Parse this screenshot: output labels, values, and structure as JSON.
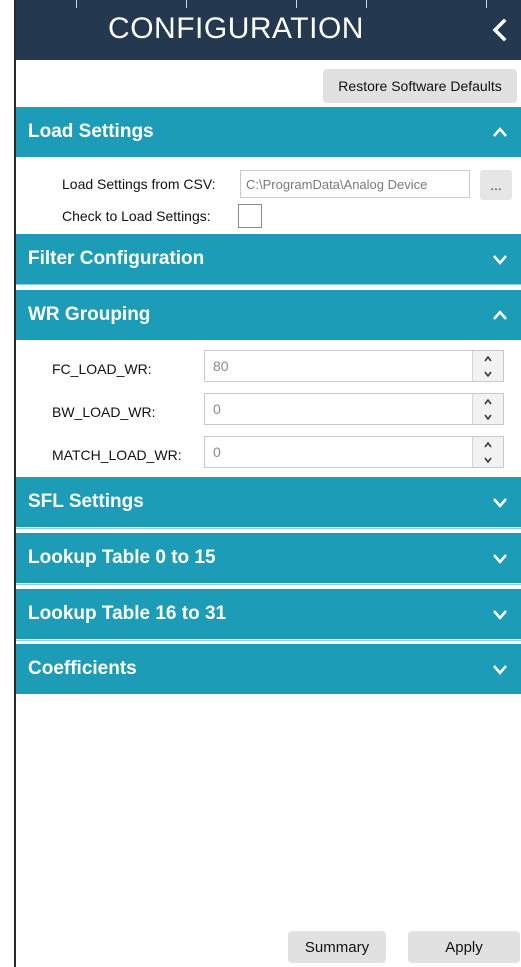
{
  "header": {
    "title": "CONFIGURATION",
    "collapse_icon": "chevron-left-icon"
  },
  "toolbar": {
    "restore_label": "Restore Software Defaults"
  },
  "sections": {
    "load_settings": {
      "title": "Load Settings",
      "expanded": true,
      "csv_label": "Load Settings from CSV:",
      "csv_path": "C:\\ProgramData\\Analog Device",
      "browse_label": "...",
      "check_label": "Check to Load Settings:",
      "checked": false
    },
    "filter_configuration": {
      "title": "Filter Configuration",
      "expanded": false
    },
    "wr_grouping": {
      "title": "WR Grouping",
      "expanded": true,
      "fields": [
        {
          "label": "FC_LOAD_WR:",
          "value": "80"
        },
        {
          "label": "BW_LOAD_WR:",
          "value": "0"
        },
        {
          "label": "MATCH_LOAD_WR:",
          "value": "0"
        }
      ]
    },
    "sfl_settings": {
      "title": "SFL Settings",
      "expanded": false
    },
    "lookup_0_15": {
      "title": "Lookup Table 0 to 15",
      "expanded": false
    },
    "lookup_16_31": {
      "title": "Lookup Table 16 to 31",
      "expanded": false
    },
    "coefficients": {
      "title": "Coefficients",
      "expanded": false
    }
  },
  "footer": {
    "summary_label": "Summary",
    "apply_label": "Apply"
  },
  "colors": {
    "header_bg": "#24384f",
    "section_bg": "#1d9cb8",
    "button_bg": "#e1e1e1"
  }
}
